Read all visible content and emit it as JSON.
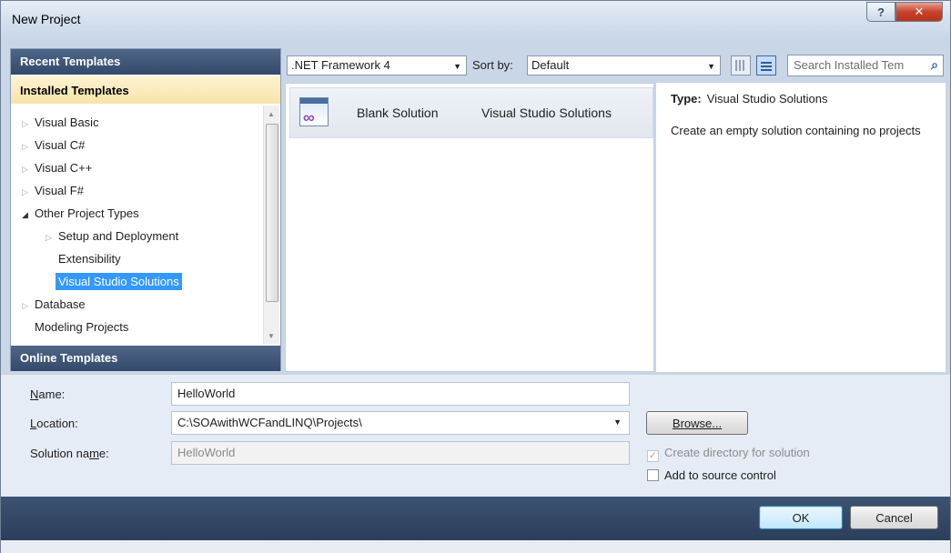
{
  "window": {
    "title": "New Project"
  },
  "left_pane": {
    "recent_header": "Recent Templates",
    "installed_header": "Installed Templates",
    "online_header": "Online Templates",
    "tree": [
      {
        "label": "Visual Basic",
        "state": "collapsed"
      },
      {
        "label": "Visual C#",
        "state": "collapsed"
      },
      {
        "label": "Visual C++",
        "state": "collapsed"
      },
      {
        "label": "Visual F#",
        "state": "collapsed"
      },
      {
        "label": "Other Project Types",
        "state": "expanded"
      },
      {
        "label": "Setup and Deployment",
        "state": "collapsed"
      },
      {
        "label": "Extensibility",
        "state": "leaf"
      },
      {
        "label": "Visual Studio Solutions",
        "state": "selected"
      },
      {
        "label": "Database",
        "state": "collapsed"
      },
      {
        "label": "Modeling Projects",
        "state": "leaf"
      }
    ]
  },
  "toolbar": {
    "framework": ".NET Framework 4",
    "sort_label": "Sort by:",
    "sort_value": "Default",
    "search_placeholder": "Search Installed Tem"
  },
  "templates": [
    {
      "name": "Blank Solution",
      "category": "Visual Studio Solutions"
    }
  ],
  "description": {
    "type_label": "Type:",
    "type_value": "Visual Studio Solutions",
    "text": "Create an empty solution containing no projects"
  },
  "form": {
    "name_label": "Name:",
    "name_value": "HelloWorld",
    "location_label": "Location:",
    "location_value": "C:\\SOAwithWCFandLINQ\\Projects\\",
    "solution_label": "Solution name:",
    "solution_value": "HelloWorld",
    "browse_label": "Browse...",
    "create_dir_label": "Create directory for solution",
    "source_control_label": "Add to source control"
  },
  "buttons": {
    "ok": "OK",
    "cancel": "Cancel"
  },
  "colors": {
    "header_dark": "#34496a",
    "installed_header": "#f8e4a8",
    "selection": "#3399ff"
  }
}
